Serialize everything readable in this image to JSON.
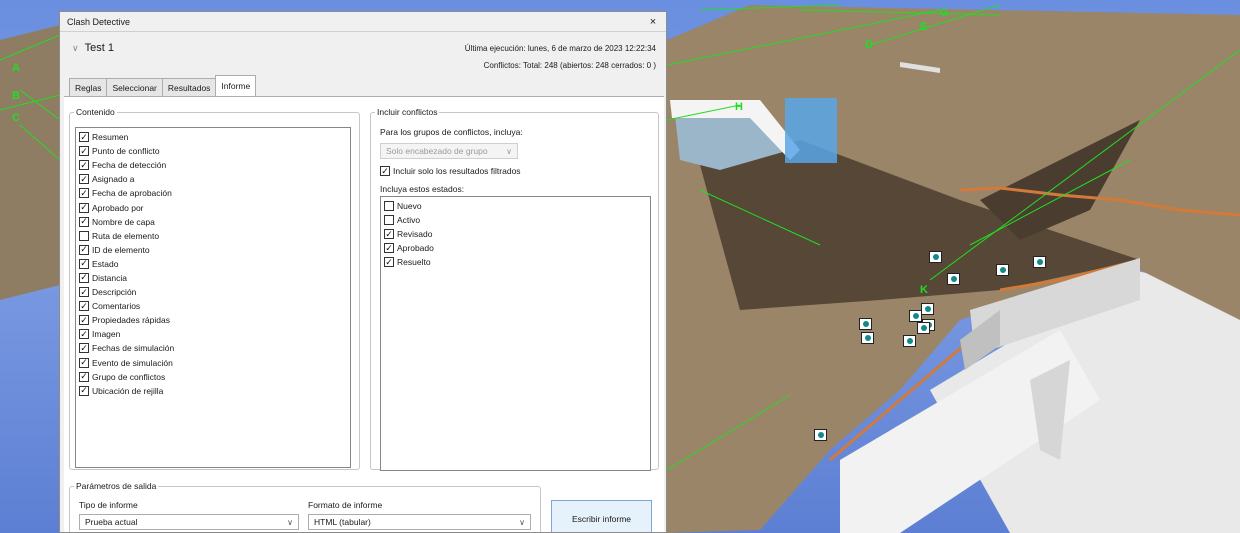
{
  "dialog": {
    "title": "Clash Detective",
    "close_glyph": "×",
    "test_name": "Test 1",
    "last_run": "Última ejecución:  lunes, 6 de marzo de 2023 12:22:34",
    "conflicts_summary": "Conflictos:  Total:  248  (abiertos:  248  cerrados:  0 )",
    "tabs": [
      {
        "label": "Reglas",
        "active": false
      },
      {
        "label": "Seleccionar",
        "active": false
      },
      {
        "label": "Resultados",
        "active": false
      },
      {
        "label": "Informe",
        "active": true
      }
    ]
  },
  "contenido": {
    "legend": "Contenido",
    "items": [
      {
        "label": "Resumen",
        "checked": true
      },
      {
        "label": "Punto de conflicto",
        "checked": true
      },
      {
        "label": "Fecha de detección",
        "checked": true
      },
      {
        "label": "Asignado a",
        "checked": true
      },
      {
        "label": "Fecha de aprobación",
        "checked": true
      },
      {
        "label": "Aprobado por",
        "checked": true
      },
      {
        "label": "Nombre de capa",
        "checked": true
      },
      {
        "label": "Ruta de elemento",
        "checked": false
      },
      {
        "label": "ID de elemento",
        "checked": true
      },
      {
        "label": "Estado",
        "checked": true
      },
      {
        "label": "Distancia",
        "checked": true
      },
      {
        "label": "Descripción",
        "checked": true
      },
      {
        "label": "Comentarios",
        "checked": true
      },
      {
        "label": "Propiedades rápidas",
        "checked": true
      },
      {
        "label": "Imagen",
        "checked": true
      },
      {
        "label": "Fechas de simulación",
        "checked": true
      },
      {
        "label": "Evento de simulación",
        "checked": true
      },
      {
        "label": "Grupo de conflictos",
        "checked": true
      },
      {
        "label": "Ubicación de rejilla",
        "checked": true
      }
    ]
  },
  "incluir": {
    "legend": "Incluir conflictos",
    "group_label": "Para los grupos de conflictos, incluya:",
    "group_select_value": "Solo encabezado de grupo",
    "filtered_label": "Incluir solo los resultados filtrados",
    "filtered_checked": true,
    "states_label": "Incluya estos estados:",
    "states": [
      {
        "label": "Nuevo",
        "checked": false
      },
      {
        "label": "Activo",
        "checked": false
      },
      {
        "label": "Revisado",
        "checked": true
      },
      {
        "label": "Aprobado",
        "checked": true
      },
      {
        "label": "Resuelto",
        "checked": true
      }
    ]
  },
  "output": {
    "legend": "Parámetros de salida",
    "report_type_label": "Tipo de informe",
    "report_type_value": "Prueba actual",
    "report_format_label": "Formato de informe",
    "report_format_value": "HTML (tabular)",
    "write_button": "Escribir informe"
  },
  "viewport": {
    "grid_labels": [
      "A",
      "B",
      "C",
      "D",
      "E",
      "G",
      "H",
      "K"
    ],
    "colors": {
      "sky": "#6b8fe0",
      "roof": "#8f7d63",
      "roof_dark": "#4f4233",
      "wall": "#e8e8e8",
      "gridline": "#22dd22",
      "marker_fill": "#128a8a"
    },
    "clash_marker_count": 14
  }
}
